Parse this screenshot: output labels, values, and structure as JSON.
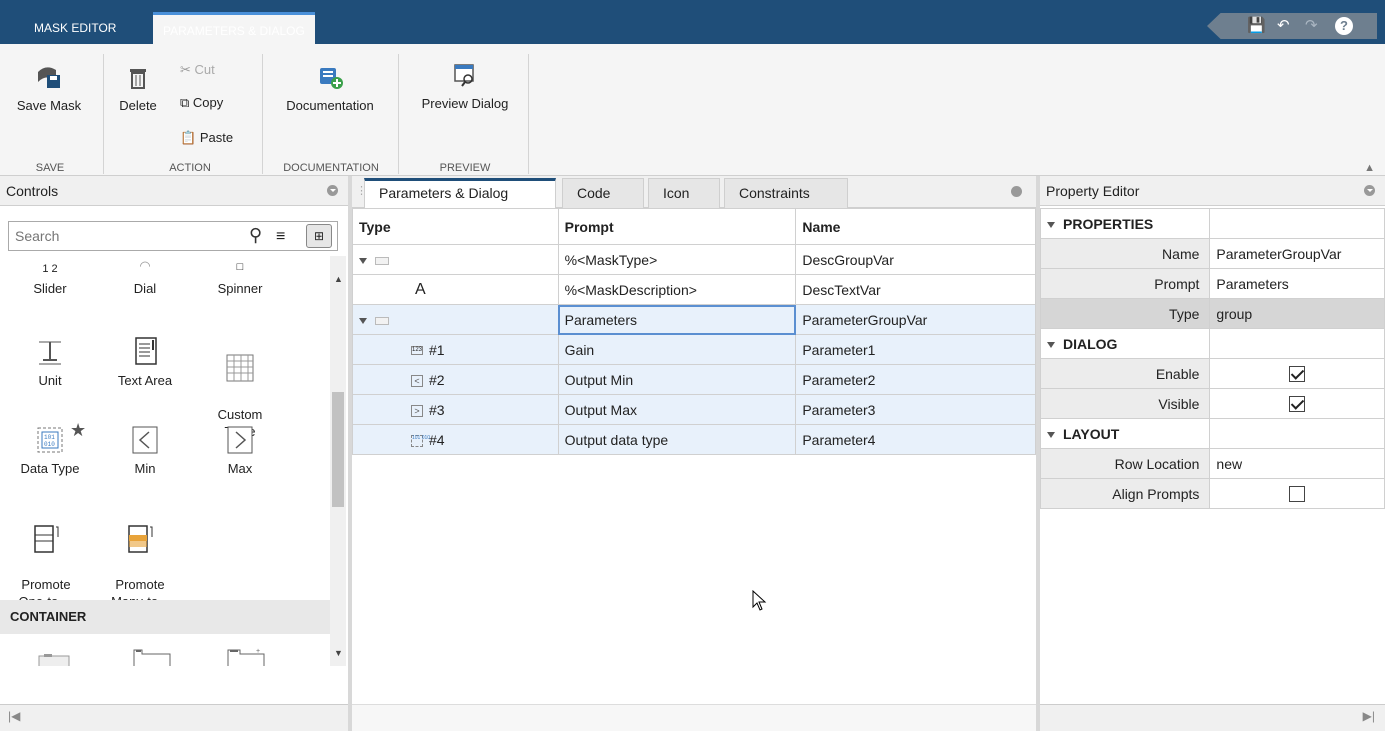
{
  "tabs": {
    "mask_editor": "MASK EDITOR",
    "params_dialog": "PARAMETERS & DIALOG"
  },
  "ribbon": {
    "save_mask": "Save Mask",
    "delete": "Delete",
    "cut": "Cut",
    "copy": "Copy",
    "paste": "Paste",
    "documentation": "Documentation",
    "preview_dialog": "Preview Dialog",
    "groups": {
      "save": "SAVE",
      "action": "ACTION",
      "documentation": "DOCUMENTATION",
      "preview": "PREVIEW"
    }
  },
  "controls": {
    "title": "Controls",
    "search_placeholder": "Search",
    "items": [
      {
        "label": "Slider"
      },
      {
        "label": "Dial"
      },
      {
        "label": "Spinner"
      },
      {
        "label": "Unit"
      },
      {
        "label": "Text Area"
      },
      {
        "label": "Custom\nTable"
      },
      {
        "label": "Data Type"
      },
      {
        "label": "Min"
      },
      {
        "label": "Max"
      },
      {
        "label": "Promote\nOne-to-..."
      },
      {
        "label": "Promote\nMany-to..."
      }
    ],
    "container_header": "CONTAINER",
    "slider_ticks": "1   2"
  },
  "center": {
    "tabs": [
      "Parameters & Dialog",
      "Code",
      "Icon",
      "Constraints"
    ],
    "columns": [
      "Type",
      "Prompt",
      "Name"
    ],
    "rows": [
      {
        "type": "",
        "prompt": "%<MaskType>",
        "name": "DescGroupVar"
      },
      {
        "type": "A",
        "prompt": "%<MaskDescription>",
        "name": "DescTextVar"
      },
      {
        "type": "",
        "prompt": "Parameters",
        "name": "ParameterGroupVar"
      },
      {
        "type": "#1",
        "prompt": "Gain",
        "name": "Parameter1"
      },
      {
        "type": "#2",
        "prompt": "Output Min",
        "name": "Parameter2"
      },
      {
        "type": "#3",
        "prompt": "Output Max",
        "name": "Parameter3"
      },
      {
        "type": "#4",
        "prompt": "Output data type",
        "name": "Parameter4"
      }
    ]
  },
  "property_editor": {
    "title": "Property Editor",
    "sections": {
      "properties": "PROPERTIES",
      "dialog": "DIALOG",
      "layout": "LAYOUT"
    },
    "name_label": "Name",
    "name_value": "ParameterGroupVar",
    "prompt_label": "Prompt",
    "prompt_value": "Parameters",
    "type_label": "Type",
    "type_value": "group",
    "enable_label": "Enable",
    "enable": true,
    "visible_label": "Visible",
    "visible": true,
    "row_location_label": "Row Location",
    "row_location_value": "new",
    "align_prompts_label": "Align Prompts",
    "align_prompts": false
  },
  "colors": {
    "topbar": "#1f4e79",
    "accent": "#4a90d9",
    "row_highlight": "#e8f1fb"
  }
}
